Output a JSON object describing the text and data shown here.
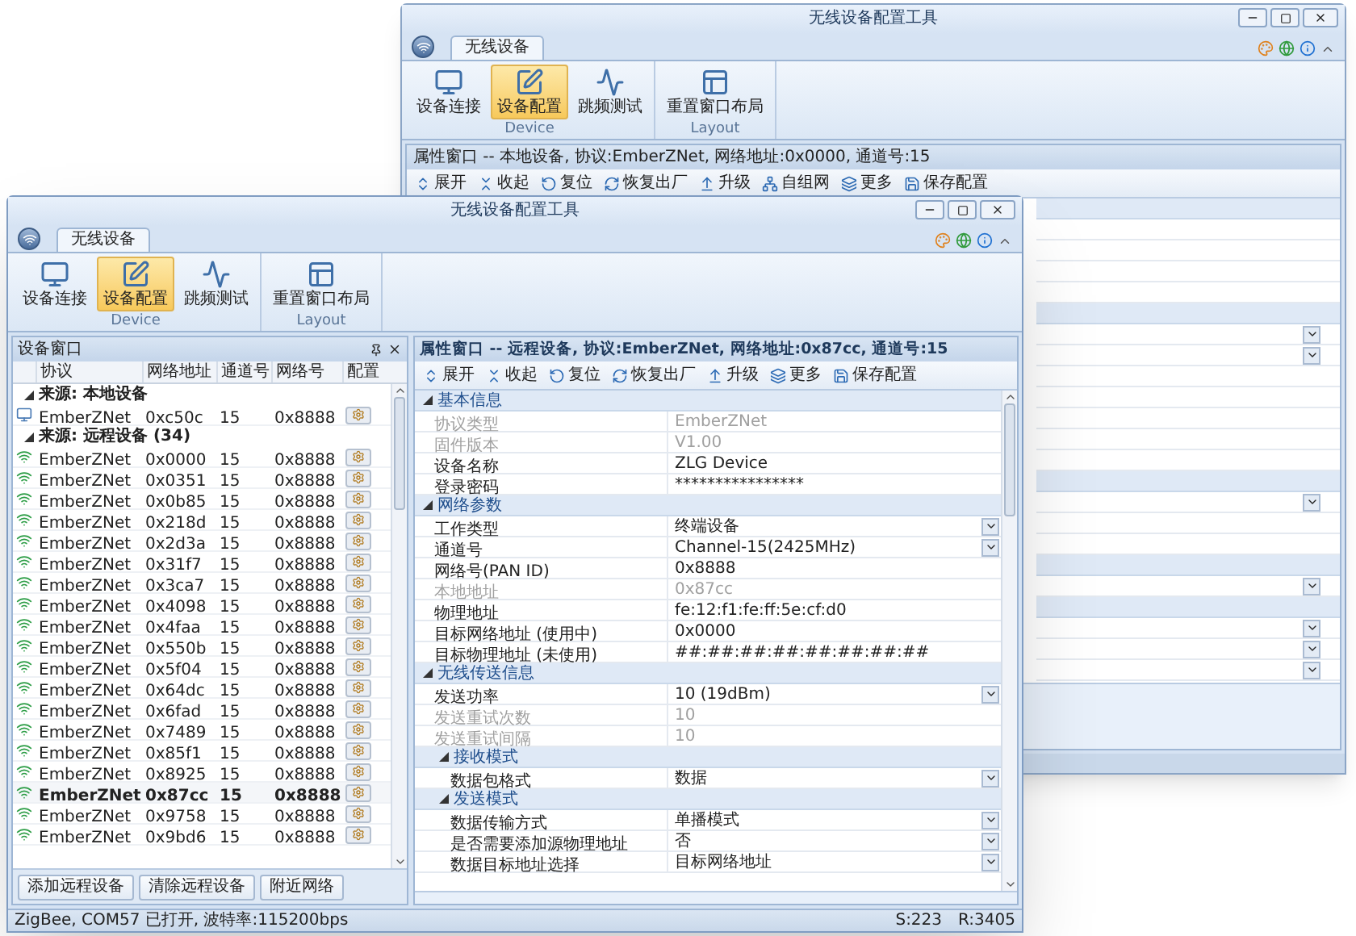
{
  "back_window": {
    "title": "无线设备配置工具",
    "ribbon": {
      "tabs": [
        {
          "label": "无线设备",
          "selected": true
        }
      ],
      "groups": [
        {
          "label": "Device",
          "buttons": [
            {
              "label": "设备连接",
              "kind": "connect",
              "selected": false
            },
            {
              "label": "设备配置",
              "kind": "config",
              "selected": true
            },
            {
              "label": "跳频测试",
              "kind": "test",
              "selected": false
            }
          ]
        },
        {
          "label": "Layout",
          "buttons": [
            {
              "label": "重置窗口布局",
              "kind": "layout",
              "selected": false
            }
          ]
        }
      ]
    },
    "property_header": "属性窗口 -- 本地设备, 协议:EmberZNet, 网络地址:0x0000, 通道号:15",
    "toolbar": [
      {
        "label": "展开",
        "kind": "expand"
      },
      {
        "label": "收起",
        "kind": "collapse"
      },
      {
        "label": "复位",
        "kind": "reset"
      },
      {
        "label": "恢复出厂",
        "kind": "factory"
      },
      {
        "label": "升级",
        "kind": "upgrade"
      },
      {
        "label": "自组网",
        "kind": "network"
      },
      {
        "label": "更多",
        "kind": "more"
      },
      {
        "label": "保存配置",
        "kind": "save"
      }
    ],
    "grid_rows": [
      {
        "kind": "group"
      },
      {
        "kind": "plain"
      },
      {
        "kind": "plain"
      },
      {
        "kind": "plain"
      },
      {
        "kind": "plain"
      },
      {
        "kind": "group"
      },
      {
        "kind": "dropdown"
      },
      {
        "kind": "dropdown"
      },
      {
        "kind": "plain"
      },
      {
        "kind": "plain"
      },
      {
        "kind": "plain"
      },
      {
        "kind": "plain"
      },
      {
        "kind": "plain"
      },
      {
        "kind": "group"
      },
      {
        "kind": "dropdown"
      },
      {
        "kind": "plain"
      },
      {
        "kind": "plain"
      },
      {
        "kind": "group"
      },
      {
        "kind": "dropdown"
      },
      {
        "kind": "group"
      },
      {
        "kind": "dropdown"
      },
      {
        "kind": "dropdown"
      },
      {
        "kind": "dropdown"
      }
    ]
  },
  "front_window": {
    "title": "无线设备配置工具",
    "ribbon": {
      "tabs": [
        {
          "label": "无线设备",
          "selected": true
        }
      ],
      "groups": [
        {
          "label": "Device",
          "buttons": [
            {
              "label": "设备连接",
              "kind": "connect",
              "selected": false
            },
            {
              "label": "设备配置",
              "kind": "config",
              "selected": true
            },
            {
              "label": "跳频测试",
              "kind": "test",
              "selected": false
            }
          ]
        },
        {
          "label": "Layout",
          "buttons": [
            {
              "label": "重置窗口布局",
              "kind": "layout",
              "selected": false
            }
          ]
        }
      ]
    },
    "device_panel": {
      "title": "设备窗口",
      "columns": [
        "协议",
        "网络地址",
        "通道号",
        "网络号",
        "配置"
      ],
      "groups": [
        {
          "title": "来源: 本地设备",
          "kind": "local",
          "expanded": true,
          "rows": [
            {
              "protocol": "EmberZNet",
              "address": "0xc50c",
              "channel": "15",
              "pan": "0x8888",
              "selected": false
            }
          ]
        },
        {
          "title": "来源: 远程设备 (34)",
          "kind": "remote",
          "expanded": true,
          "rows": [
            {
              "protocol": "EmberZNet",
              "address": "0x0000",
              "channel": "15",
              "pan": "0x8888",
              "selected": false
            },
            {
              "protocol": "EmberZNet",
              "address": "0x0351",
              "channel": "15",
              "pan": "0x8888",
              "selected": false
            },
            {
              "protocol": "EmberZNet",
              "address": "0x0b85",
              "channel": "15",
              "pan": "0x8888",
              "selected": false
            },
            {
              "protocol": "EmberZNet",
              "address": "0x218d",
              "channel": "15",
              "pan": "0x8888",
              "selected": false
            },
            {
              "protocol": "EmberZNet",
              "address": "0x2d3a",
              "channel": "15",
              "pan": "0x8888",
              "selected": false
            },
            {
              "protocol": "EmberZNet",
              "address": "0x31f7",
              "channel": "15",
              "pan": "0x8888",
              "selected": false
            },
            {
              "protocol": "EmberZNet",
              "address": "0x3ca7",
              "channel": "15",
              "pan": "0x8888",
              "selected": false
            },
            {
              "protocol": "EmberZNet",
              "address": "0x4098",
              "channel": "15",
              "pan": "0x8888",
              "selected": false
            },
            {
              "protocol": "EmberZNet",
              "address": "0x4faa",
              "channel": "15",
              "pan": "0x8888",
              "selected": false
            },
            {
              "protocol": "EmberZNet",
              "address": "0x550b",
              "channel": "15",
              "pan": "0x8888",
              "selected": false
            },
            {
              "protocol": "EmberZNet",
              "address": "0x5f04",
              "channel": "15",
              "pan": "0x8888",
              "selected": false
            },
            {
              "protocol": "EmberZNet",
              "address": "0x64dc",
              "channel": "15",
              "pan": "0x8888",
              "selected": false
            },
            {
              "protocol": "EmberZNet",
              "address": "0x6fad",
              "channel": "15",
              "pan": "0x8888",
              "selected": false
            },
            {
              "protocol": "EmberZNet",
              "address": "0x7489",
              "channel": "15",
              "pan": "0x8888",
              "selected": false
            },
            {
              "protocol": "EmberZNet",
              "address": "0x85f1",
              "channel": "15",
              "pan": "0x8888",
              "selected": false
            },
            {
              "protocol": "EmberZNet",
              "address": "0x8925",
              "channel": "15",
              "pan": "0x8888",
              "selected": false
            },
            {
              "protocol": "EmberZNet",
              "address": "0x87cc",
              "channel": "15",
              "pan": "0x8888",
              "selected": true
            },
            {
              "protocol": "EmberZNet",
              "address": "0x9758",
              "channel": "15",
              "pan": "0x8888",
              "selected": false
            },
            {
              "protocol": "EmberZNet",
              "address": "0x9bd6",
              "channel": "15",
              "pan": "0x8888",
              "selected": false
            }
          ]
        }
      ],
      "buttons": [
        "添加远程设备",
        "清除远程设备",
        "附近网络"
      ]
    },
    "property_panel": {
      "header": "属性窗口 -- 远程设备, 协议:EmberZNet, 网络地址:0x87cc, 通道号:15",
      "toolbar": [
        {
          "label": "展开",
          "kind": "expand"
        },
        {
          "label": "收起",
          "kind": "collapse"
        },
        {
          "label": "复位",
          "kind": "reset"
        },
        {
          "label": "恢复出厂",
          "kind": "factory"
        },
        {
          "label": "升级",
          "kind": "upgrade"
        },
        {
          "label": "更多",
          "kind": "more"
        },
        {
          "label": "保存配置",
          "kind": "save"
        }
      ],
      "groups": [
        {
          "title": "基本信息",
          "expanded": true,
          "rows": [
            {
              "name": "协议类型",
              "value": "EmberZNet",
              "disabled": true,
              "dropdown": false
            },
            {
              "name": "固件版本",
              "value": "V1.00",
              "disabled": true,
              "dropdown": false
            },
            {
              "name": "设备名称",
              "value": "ZLG Device",
              "disabled": false,
              "dropdown": false
            },
            {
              "name": "登录密码",
              "value": "****************",
              "disabled": false,
              "dropdown": false
            }
          ]
        },
        {
          "title": "网络参数",
          "expanded": true,
          "rows": [
            {
              "name": "工作类型",
              "value": "终端设备",
              "disabled": false,
              "dropdown": true
            },
            {
              "name": "通道号",
              "value": "Channel-15(2425MHz)",
              "disabled": false,
              "dropdown": true
            },
            {
              "name": "网络号(PAN ID)",
              "value": "0x8888",
              "disabled": false,
              "dropdown": false
            },
            {
              "name": "本地地址",
              "value": "0x87cc",
              "disabled": true,
              "dropdown": false
            },
            {
              "name": "物理地址",
              "value": "fe:12:f1:fe:ff:5e:cf:d0",
              "disabled": false,
              "dropdown": false
            },
            {
              "name": "目标网络地址 (使用中)",
              "value": "0x0000",
              "disabled": false,
              "dropdown": false
            },
            {
              "name": "目标物理地址 (未使用)",
              "value": "##:##:##:##:##:##:##:##",
              "disabled": false,
              "dropdown": false
            }
          ]
        },
        {
          "title": "无线传送信息",
          "expanded": true,
          "rows": [
            {
              "name": "发送功率",
              "value": "10 (19dBm)",
              "disabled": false,
              "dropdown": true
            },
            {
              "name": "发送重试次数",
              "value": "10",
              "disabled": true,
              "dropdown": false
            },
            {
              "name": "发送重试间隔",
              "value": "10",
              "disabled": true,
              "dropdown": false
            }
          ],
          "children": [
            {
              "title": "接收模式",
              "expanded": true,
              "rows": [
                {
                  "name": "数据包格式",
                  "value": "数据",
                  "disabled": false,
                  "dropdown": true
                }
              ]
            },
            {
              "title": "发送模式",
              "expanded": true,
              "rows": [
                {
                  "name": "数据传输方式",
                  "value": "单播模式",
                  "disabled": false,
                  "dropdown": true
                },
                {
                  "name": "是否需要添加源物理地址",
                  "value": "否",
                  "disabled": false,
                  "dropdown": true
                },
                {
                  "name": "数据目标地址选择",
                  "value": "目标网络地址",
                  "disabled": false,
                  "dropdown": true
                }
              ]
            }
          ]
        }
      ]
    },
    "status_bar": [
      "ZigBee, COM57 已打开, 波特率:115200bps",
      "S:223",
      "R:3405"
    ]
  }
}
